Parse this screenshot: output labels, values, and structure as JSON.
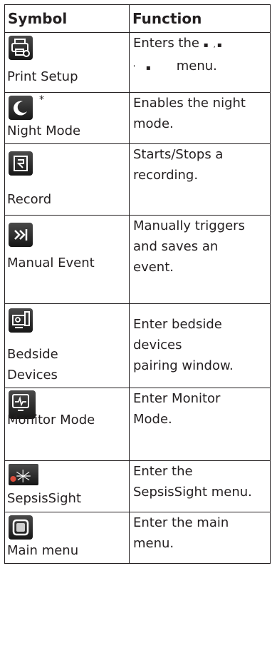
{
  "header": {
    "symbol": "Symbol",
    "function": "Function"
  },
  "rows": [
    {
      "icon": "print-setup-icon",
      "label": "Print Setup",
      "func1": "Enters the",
      "func2": "menu."
    },
    {
      "icon": "night-mode-icon",
      "label": "Night Mode",
      "note": "*",
      "func1": "Enables the night",
      "func2": "mode."
    },
    {
      "icon": "record-icon",
      "label": "Record",
      "func1": "Starts/Stops a",
      "func2": "recording."
    },
    {
      "icon": "manual-event-icon",
      "label": "Manual Event",
      "func1": "Manually triggers",
      "func2": "and saves an",
      "func3": "event."
    },
    {
      "icon": "bedside-devices-icon",
      "label1": "Bedside",
      "label2": "Devices",
      "func1": "Enter bedside",
      "func2": "devices",
      "func3": "pairing window."
    },
    {
      "icon": "monitor-mode-icon",
      "label": "Monitor Mode",
      "func1": "Enter Monitor",
      "func2": "Mode."
    },
    {
      "icon": "sepsissight-icon",
      "label": "SepsisSight",
      "func1": "Enter the",
      "func2": "SepsisSight menu."
    },
    {
      "icon": "main-menu-icon",
      "label": "Main menu",
      "func1": "Enter the main",
      "func2": "menu."
    }
  ]
}
